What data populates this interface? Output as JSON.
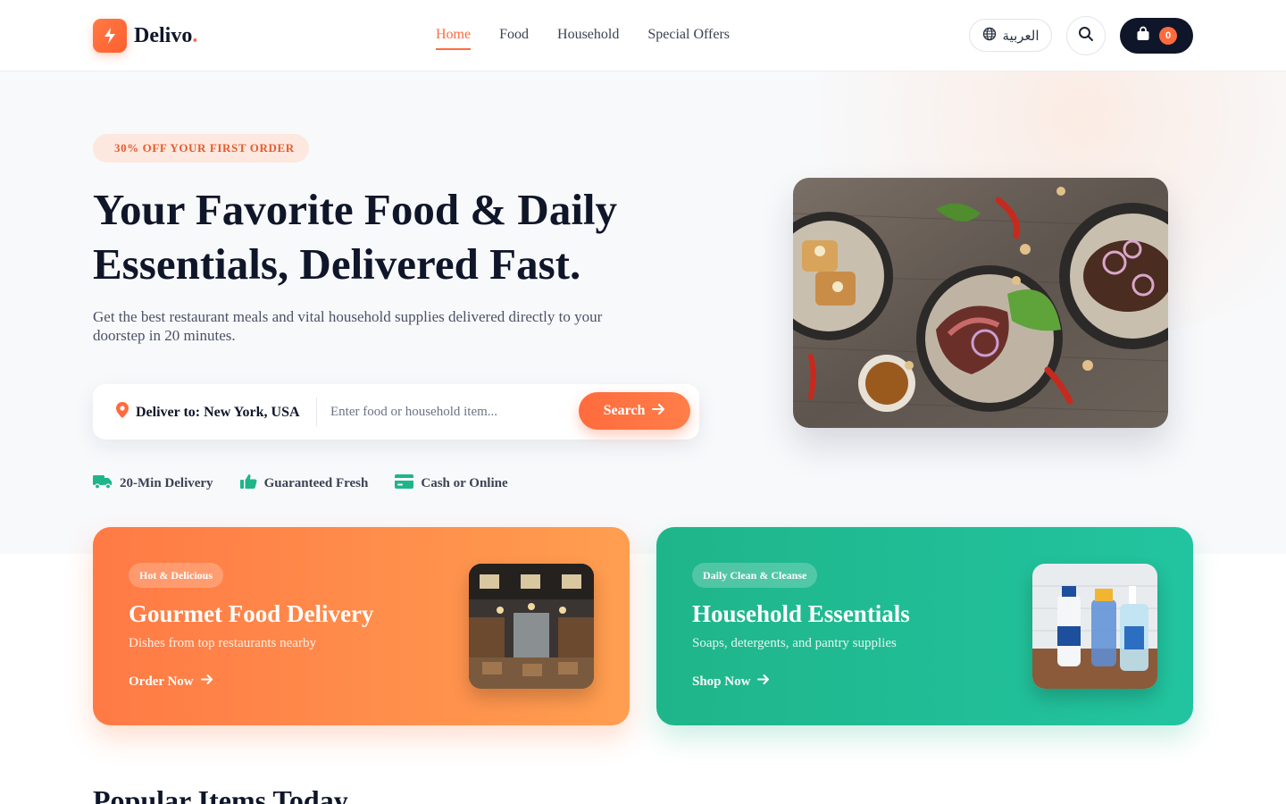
{
  "brand": {
    "name": "Delivo",
    "dot": "."
  },
  "nav": {
    "items": [
      "Home",
      "Food",
      "Household",
      "Special Offers"
    ],
    "active": "Home"
  },
  "header": {
    "language_label": "العربية",
    "cart_count": "0"
  },
  "hero": {
    "badge": "30% OFF YOUR FIRST ORDER",
    "title_line1": "Your Favorite Food & Daily",
    "title_line2": "Essentials, Delivered Fast.",
    "subtitle": "Get the best restaurant meals and vital household supplies delivered directly to your doorstep in 20 minutes.",
    "deliver_to": "Deliver to: New York, USA",
    "search_placeholder": "Enter food or household item...",
    "search_button": "Search",
    "features": [
      "20-Min Delivery",
      "Guaranteed Fresh",
      "Cash or Online"
    ]
  },
  "cards": {
    "food": {
      "tag": "Hot & Delicious",
      "title": "Gourmet Food Delivery",
      "desc": "Dishes from top restaurants nearby",
      "link": "Order Now"
    },
    "home": {
      "tag": "Daily Clean & Cleanse",
      "title": "Household Essentials",
      "desc": "Soaps, detergents, and pantry supplies",
      "link": "Shop Now"
    }
  },
  "sections": {
    "popular_title": "Popular Items Today"
  },
  "colors": {
    "accent": "#ff6b3d",
    "dark": "#0f1629",
    "green": "#1fb58a"
  },
  "icons": [
    "bolt-icon",
    "globe-icon",
    "search-icon",
    "shopping-bag-icon",
    "map-pin-icon",
    "arrow-right-icon",
    "truck-icon",
    "thumbs-up-icon",
    "credit-card-icon"
  ]
}
